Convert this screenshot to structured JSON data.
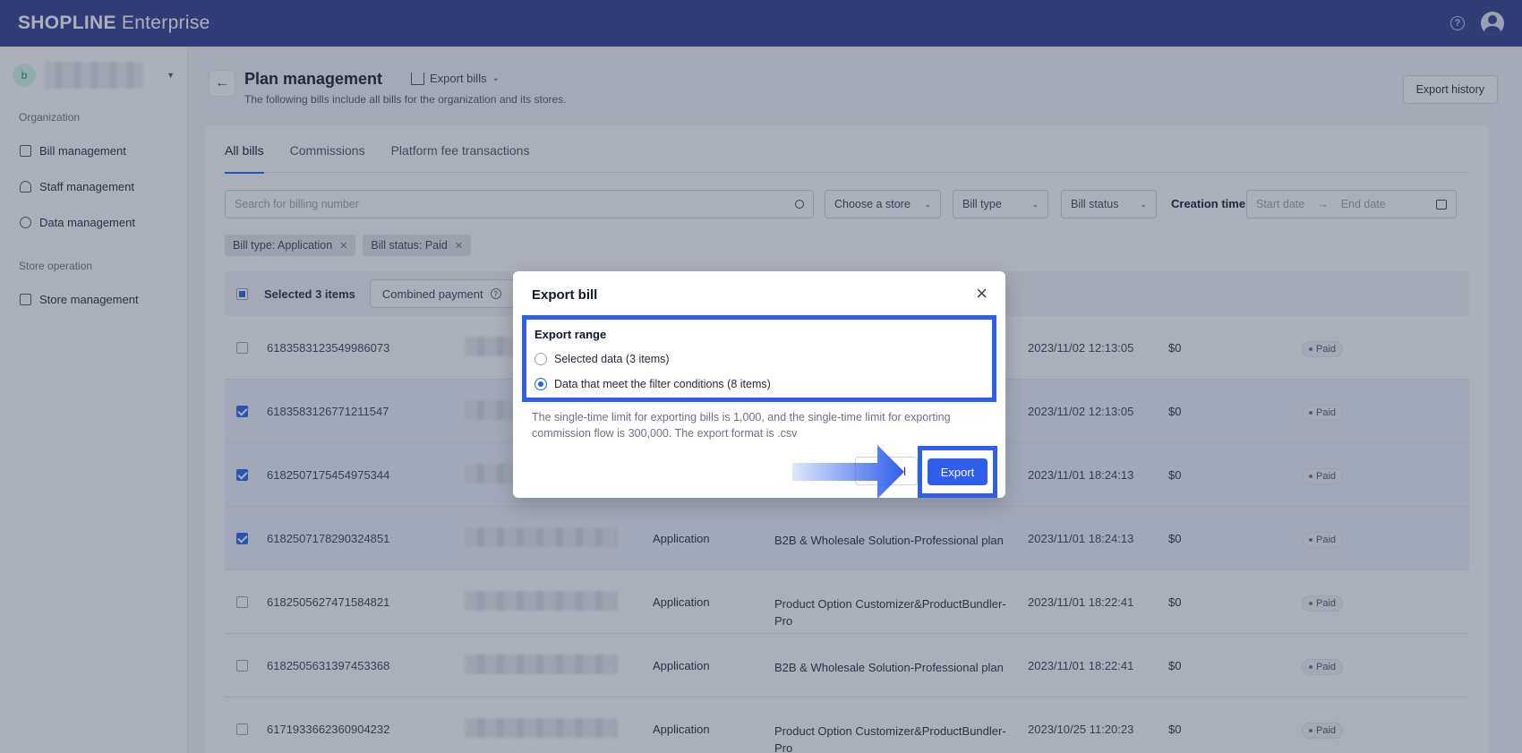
{
  "topbar": {
    "brand_bold": "SHOPLINE",
    "brand_rest": " Enterprise",
    "help_glyph": "?"
  },
  "sidebar": {
    "store_initial": "b",
    "sections": [
      {
        "title": "Organization",
        "items": [
          "Bill management",
          "Staff management",
          "Data management"
        ]
      },
      {
        "title": "Store operation",
        "items": [
          "Store management"
        ]
      }
    ]
  },
  "header": {
    "title": "Plan management",
    "export_bills": "Export bills",
    "subtitle": "The following bills include all bills for the organization and its stores.",
    "export_history": "Export history"
  },
  "tabs": [
    "All bills",
    "Commissions",
    "Platform fee transactions"
  ],
  "filters": {
    "search_placeholder": "Search for billing number",
    "store": "Choose a store",
    "bill_type": "Bill type",
    "bill_status": "Bill status",
    "creation_time": "Creation time",
    "start_date": "Start date",
    "end_date": "End date",
    "arrow": "→"
  },
  "chips": [
    "Bill type: Application",
    "Bill status: Paid"
  ],
  "selection": {
    "text": "Selected 3 items",
    "combined_payment": "Combined payment",
    "q": "?"
  },
  "rows": [
    {
      "id": "6183583123549986073",
      "type": "",
      "plan": "",
      "time": "2023/11/02 12:13:05",
      "amount": "$0",
      "status": "Paid",
      "checked": false
    },
    {
      "id": "6183583126771211547",
      "type": "",
      "plan": "",
      "time": "2023/11/02 12:13:05",
      "amount": "$0",
      "status": "Paid",
      "checked": true
    },
    {
      "id": "6182507175454975344",
      "type": "",
      "plan": "",
      "time": "2023/11/01 18:24:13",
      "amount": "$0",
      "status": "Paid",
      "checked": true
    },
    {
      "id": "6182507178290324851",
      "type": "Application",
      "plan": "B2B & Wholesale Solution-Professional plan",
      "time": "2023/11/01 18:24:13",
      "amount": "$0",
      "status": "Paid",
      "checked": true
    },
    {
      "id": "6182505627471584821",
      "type": "Application",
      "plan": "Product Option Customizer&ProductBundler-Pro",
      "time": "2023/11/01 18:22:41",
      "amount": "$0",
      "status": "Paid",
      "checked": false
    },
    {
      "id": "6182505631397453368",
      "type": "Application",
      "plan": "B2B & Wholesale Solution-Professional plan",
      "time": "2023/11/01 18:22:41",
      "amount": "$0",
      "status": "Paid",
      "checked": false
    },
    {
      "id": "6171933662360904232",
      "type": "Application",
      "plan": "Product Option Customizer&ProductBundler-Pro",
      "time": "2023/10/25 11:20:23",
      "amount": "$0",
      "status": "Paid",
      "checked": false
    }
  ],
  "modal": {
    "title": "Export bill",
    "close_glyph": "×",
    "range_label": "Export range",
    "option_selected": "Selected data (3 items)",
    "option_filter": "Data that meet the filter conditions (8 items)",
    "note": "The single-time limit for exporting bills is 1,000, and the single-time limit for exporting commission flow is 300,000. The export format is .csv",
    "cancel": "l",
    "export": "Export"
  },
  "colors": {
    "topbar": "#2d3a8c",
    "accent": "#2563eb",
    "highlight": "#2f5eea"
  }
}
